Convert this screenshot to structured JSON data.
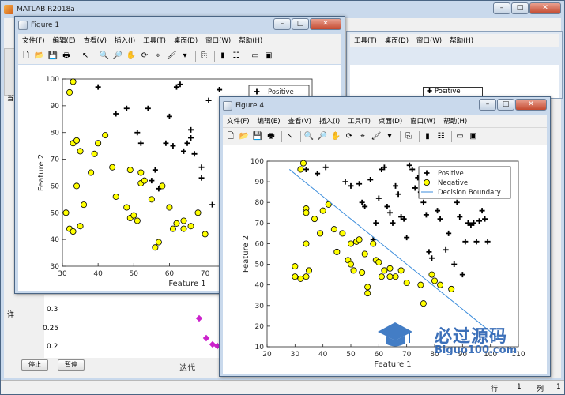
{
  "main": {
    "title": "MATLAB R2018a",
    "controls": {
      "minimize": "–",
      "maximize": "□",
      "close": "✕"
    },
    "status": {
      "row_label": "行",
      "row_value": "1",
      "col_label": "列",
      "col_value": "1"
    },
    "buttons": {
      "stop": "停止",
      "pause": "暂停"
    },
    "iter_label": "迭代",
    "bg_ticks": [
      "0.3",
      "0.25",
      "0.2"
    ],
    "side_char": "详",
    "side_icon_text": "当",
    "colors": {
      "title_bg": "#c9d9ec",
      "border": "#4a6584"
    }
  },
  "menu_labels": [
    "文件(F)",
    "编辑(E)",
    "查看(V)",
    "插入(I)",
    "工具(T)",
    "桌面(D)",
    "窗口(W)",
    "帮助(H)"
  ],
  "figure1": {
    "title": "Figure 1"
  },
  "figure4": {
    "title": "Figure 4"
  },
  "chart_data": [
    {
      "type": "scatter",
      "title": "",
      "xlabel": "Feature 1",
      "ylabel": "Feature 2",
      "xlim": [
        30,
        100
      ],
      "ylim": [
        30,
        100
      ],
      "xticks": [
        30,
        40,
        50,
        60,
        70,
        80,
        90,
        100
      ],
      "yticks": [
        30,
        40,
        50,
        60,
        70,
        80,
        90,
        100
      ],
      "legend": {
        "placement": "top-right",
        "entries": [
          "Positive",
          "Negative"
        ]
      },
      "series": [
        {
          "name": "Positive",
          "marker": "plus",
          "color": "#000000",
          "points": [
            [
              40,
              97
            ],
            [
              45,
              87
            ],
            [
              48,
              89
            ],
            [
              54,
              89
            ],
            [
              51,
              80
            ],
            [
              52,
              76
            ],
            [
              55,
              62
            ],
            [
              56,
              66
            ],
            [
              57,
              59
            ],
            [
              59,
              76
            ],
            [
              60,
              86
            ],
            [
              61,
              75
            ],
            [
              62,
              97
            ],
            [
              63,
              98
            ],
            [
              64,
              73
            ],
            [
              65,
              76
            ],
            [
              66,
              81
            ],
            [
              66,
              78
            ],
            [
              67,
              72
            ],
            [
              69,
              63
            ],
            [
              69,
              67
            ],
            [
              71,
              92
            ],
            [
              72,
              53
            ],
            [
              74,
              96
            ],
            [
              75,
              84
            ]
          ]
        },
        {
          "name": "Negative",
          "marker": "circle",
          "color": "#ffff00",
          "points": [
            [
              31,
              50
            ],
            [
              32,
              95
            ],
            [
              33,
              99
            ],
            [
              32,
              44
            ],
            [
              33,
              43
            ],
            [
              33,
              76
            ],
            [
              34,
              77
            ],
            [
              34,
              60
            ],
            [
              35,
              45
            ],
            [
              35,
              73
            ],
            [
              36,
              53
            ],
            [
              38,
              65
            ],
            [
              39,
              72
            ],
            [
              40,
              76
            ],
            [
              42,
              79
            ],
            [
              44,
              67
            ],
            [
              45,
              56
            ],
            [
              48,
              52
            ],
            [
              49,
              48
            ],
            [
              49,
              66
            ],
            [
              50,
              49
            ],
            [
              51,
              47
            ],
            [
              52,
              61
            ],
            [
              52,
              65
            ],
            [
              53,
              62
            ],
            [
              55,
              55
            ],
            [
              56,
              37
            ],
            [
              57,
              39
            ],
            [
              58,
              60
            ],
            [
              60,
              52
            ],
            [
              61,
              44
            ],
            [
              62,
              46
            ],
            [
              64,
              47
            ],
            [
              64,
              44
            ],
            [
              66,
              45
            ],
            [
              68,
              50
            ],
            [
              70,
              42
            ]
          ]
        }
      ]
    },
    {
      "type": "scatter",
      "title": "",
      "xlabel": "Feature 1",
      "ylabel": "Feature 2",
      "xlim": [
        20,
        110
      ],
      "ylim": [
        10,
        100
      ],
      "xticks": [
        20,
        30,
        40,
        50,
        60,
        70,
        80,
        90,
        100,
        110
      ],
      "yticks": [
        10,
        20,
        30,
        40,
        50,
        60,
        70,
        80,
        90,
        100
      ],
      "legend": {
        "placement": "top-right",
        "entries": [
          "Positive",
          "Negative",
          "Decision Boundary"
        ]
      },
      "series": [
        {
          "name": "Positive",
          "marker": "plus",
          "color": "#000000",
          "points": [
            [
              34,
              96
            ],
            [
              38,
              94
            ],
            [
              41,
              97
            ],
            [
              48,
              90
            ],
            [
              50,
              88
            ],
            [
              53,
              89
            ],
            [
              54,
              80
            ],
            [
              55,
              78
            ],
            [
              57,
              91
            ],
            [
              58,
              62
            ],
            [
              59,
              70
            ],
            [
              60,
              82
            ],
            [
              61,
              96
            ],
            [
              62,
              97
            ],
            [
              63,
              78
            ],
            [
              64,
              75
            ],
            [
              65,
              70
            ],
            [
              66,
              88
            ],
            [
              67,
              84
            ],
            [
              68,
              73
            ],
            [
              69,
              72
            ],
            [
              70,
              63
            ],
            [
              71,
              98
            ],
            [
              72,
              96
            ],
            [
              73,
              87
            ],
            [
              74,
              92
            ],
            [
              75,
              85
            ],
            [
              76,
              80
            ],
            [
              77,
              74
            ],
            [
              78,
              56
            ],
            [
              79,
              53
            ],
            [
              80,
              94
            ],
            [
              81,
              76
            ],
            [
              82,
              72
            ],
            [
              83,
              96
            ],
            [
              84,
              57
            ],
            [
              85,
              65
            ],
            [
              86,
              91
            ],
            [
              87,
              50
            ],
            [
              88,
              80
            ],
            [
              89,
              73
            ],
            [
              90,
              45
            ],
            [
              91,
              61
            ],
            [
              92,
              70
            ],
            [
              93,
              69
            ],
            [
              94,
              70
            ],
            [
              95,
              61
            ],
            [
              96,
              71
            ],
            [
              97,
              76
            ],
            [
              98,
              72
            ],
            [
              99,
              61
            ]
          ]
        },
        {
          "name": "Negative",
          "marker": "circle",
          "color": "#ffff00",
          "points": [
            [
              30,
              49
            ],
            [
              30,
              44
            ],
            [
              32,
              96
            ],
            [
              32,
              43
            ],
            [
              33,
              99
            ],
            [
              34,
              44
            ],
            [
              34,
              77
            ],
            [
              34,
              75
            ],
            [
              34,
              60
            ],
            [
              35,
              47
            ],
            [
              37,
              72
            ],
            [
              39,
              65
            ],
            [
              40,
              76
            ],
            [
              42,
              79
            ],
            [
              44,
              67
            ],
            [
              45,
              56
            ],
            [
              47,
              65
            ],
            [
              49,
              52
            ],
            [
              50,
              50
            ],
            [
              50,
              60
            ],
            [
              51,
              47
            ],
            [
              52,
              61
            ],
            [
              53,
              62
            ],
            [
              54,
              46
            ],
            [
              55,
              55
            ],
            [
              56,
              36
            ],
            [
              56,
              39
            ],
            [
              58,
              60
            ],
            [
              59,
              52
            ],
            [
              60,
              51
            ],
            [
              61,
              44
            ],
            [
              62,
              47
            ],
            [
              64,
              48
            ],
            [
              64,
              44
            ],
            [
              66,
              44
            ],
            [
              68,
              47
            ],
            [
              70,
              41
            ],
            [
              75,
              40
            ],
            [
              76,
              31
            ],
            [
              79,
              45
            ],
            [
              80,
              42
            ],
            [
              82,
              40
            ],
            [
              86,
              38
            ]
          ]
        },
        {
          "name": "Decision Boundary",
          "type": "line",
          "color": "#3c8ddc",
          "points": [
            [
              28,
              96
            ],
            [
              103,
              14
            ]
          ]
        }
      ]
    }
  ]
}
